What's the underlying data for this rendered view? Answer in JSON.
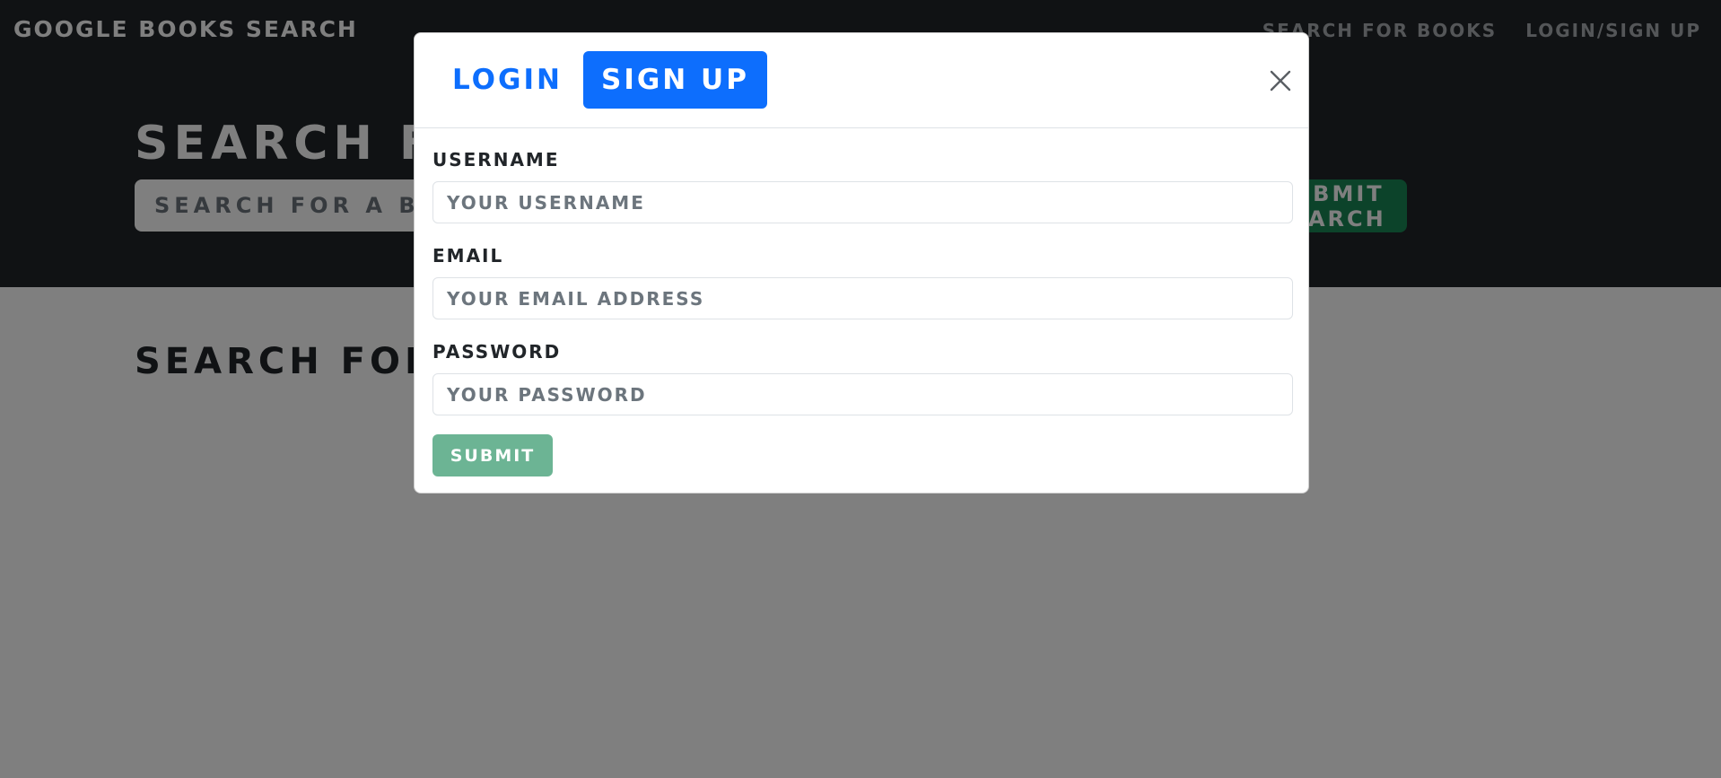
{
  "background": {
    "brand": "GOOGLE BOOKS SEARCH",
    "nav": {
      "search_books": "SEARCH FOR BOOKS",
      "login_signup": "LOGIN/SIGN UP"
    },
    "hero": {
      "title": "SEARCH FOR BOOKS!",
      "search_placeholder": "SEARCH FOR A BOOK",
      "search_button": "SUBMIT SEARCH"
    },
    "results_title": "SEARCH FOR A BOOK TO BEGIN"
  },
  "modal": {
    "tabs": {
      "login": "LOGIN",
      "signup": "SIGN UP"
    },
    "active_tab": "signup",
    "fields": {
      "username": {
        "label": "USERNAME",
        "placeholder": "YOUR USERNAME",
        "value": ""
      },
      "email": {
        "label": "EMAIL",
        "placeholder": "YOUR EMAIL ADDRESS",
        "value": ""
      },
      "password": {
        "label": "PASSWORD",
        "placeholder": "YOUR PASSWORD",
        "value": ""
      }
    },
    "submit_label": "SUBMIT",
    "close_icon": "close-icon"
  },
  "colors": {
    "primary": "#0d6efd",
    "success": "#198754",
    "submit_disabled": "#6cb494",
    "dark": "#212529"
  }
}
